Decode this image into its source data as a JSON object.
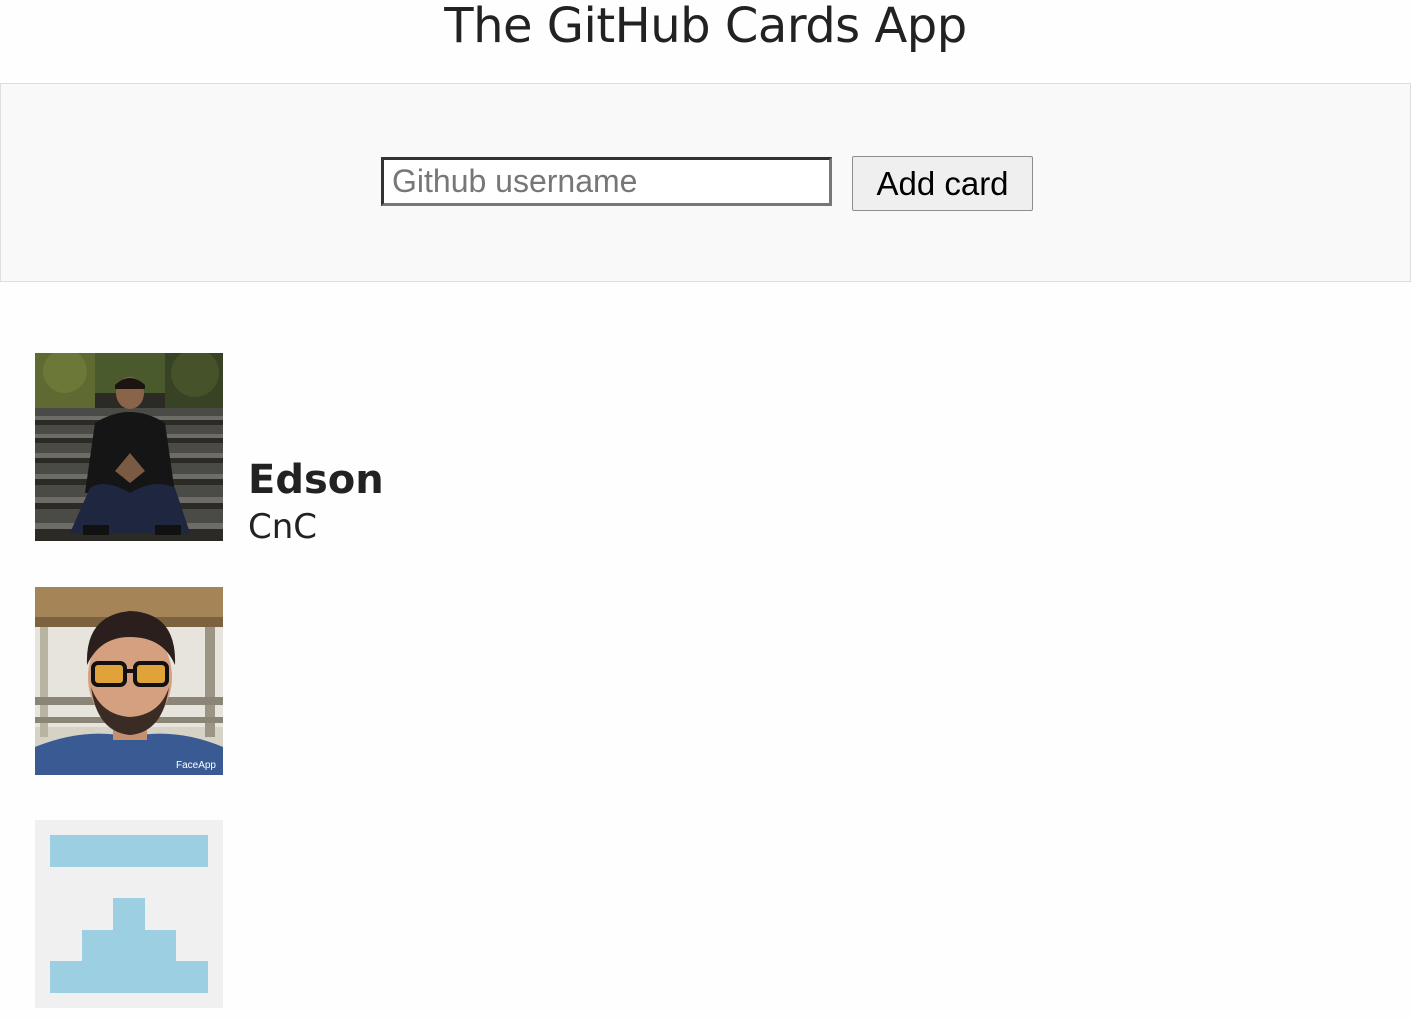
{
  "app": {
    "title": "The GitHub Cards App"
  },
  "form": {
    "input_placeholder": "Github username",
    "input_value": "",
    "button_label": "Add card"
  },
  "cards": [
    {
      "name": "Edson",
      "company": "CnC",
      "avatar": "photo-avatar-person-sitting-on-steps"
    },
    {
      "name": "",
      "company": "",
      "avatar": "photo-avatar-man-with-glasses",
      "avatar_watermark": "FaceApp"
    },
    {
      "name": "",
      "company": "",
      "avatar": "identicon-avatar",
      "identicon_color": "#9dcfe3",
      "identicon_background": "#f0f0f0"
    }
  ]
}
